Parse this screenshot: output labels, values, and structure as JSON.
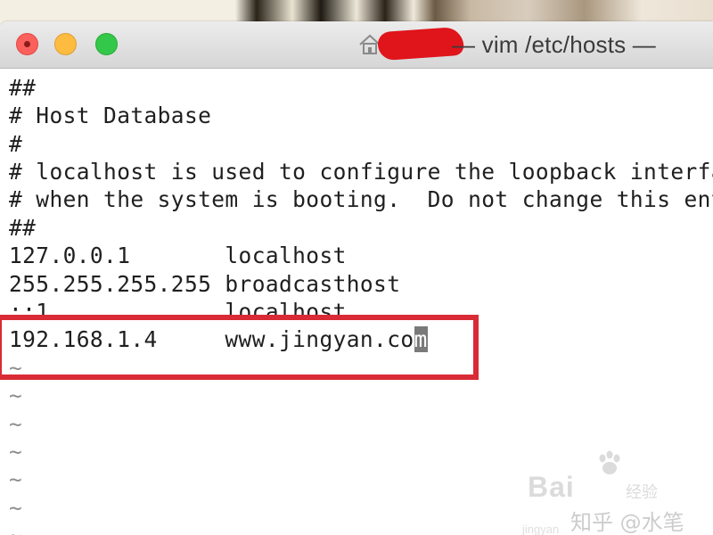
{
  "window": {
    "title": "— vim /etc/hosts —"
  },
  "editor": {
    "lines": [
      "##",
      "# Host Database",
      "#",
      "# localhost is used to configure the loopback interface",
      "# when the system is booting.  Do not change this entry.",
      "##",
      "127.0.0.1       localhost",
      "255.255.255.255 broadcasthost",
      "::1             localhost"
    ],
    "edited_line_prefix": "192.168.1.4     www.jingyan.co",
    "edited_line_cursor_char": "m",
    "empty_marker": "~"
  },
  "watermark": {
    "brand": "Bai",
    "sub": "经验",
    "zhihu": "知乎 @水笔",
    "url": "jingyan"
  },
  "colors": {
    "highlight_box": "#d92b35",
    "redaction": "#e0141b",
    "close": "#fc605c",
    "minimize": "#fdbc40",
    "zoom": "#34c84a"
  },
  "icons": [
    "home-icon",
    "paw-icon"
  ]
}
